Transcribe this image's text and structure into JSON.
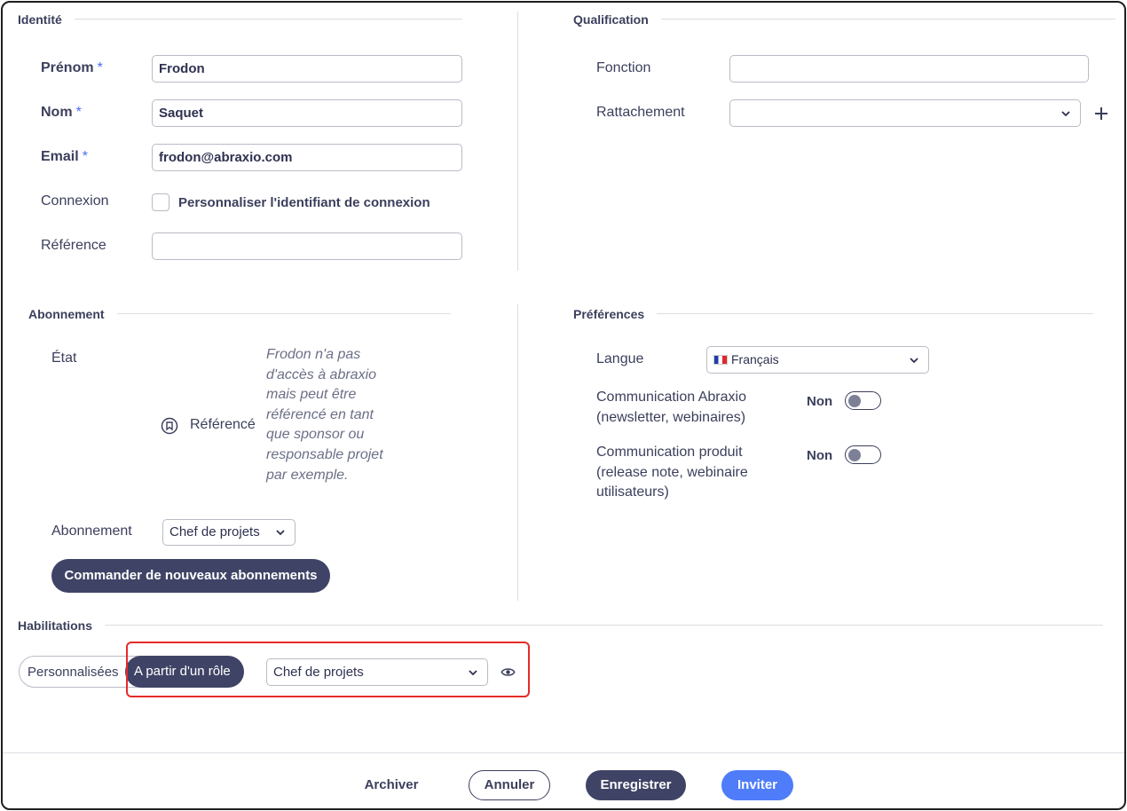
{
  "identite": {
    "title": "Identité",
    "prenom": {
      "label": "Prénom",
      "required": "*",
      "value": "Frodon"
    },
    "nom": {
      "label": "Nom",
      "required": "*",
      "value": "Saquet"
    },
    "email": {
      "label": "Email",
      "required": "*",
      "value": "frodon@abraxio.com"
    },
    "connexion": {
      "label": "Connexion",
      "checkbox_label": "Personnaliser l'identifiant de connexion"
    },
    "reference": {
      "label": "Référence",
      "value": ""
    }
  },
  "qualification": {
    "title": "Qualification",
    "fonction": {
      "label": "Fonction",
      "value": ""
    },
    "rattachement": {
      "label": "Rattachement",
      "value": ""
    }
  },
  "abonnement": {
    "title": "Abonnement",
    "etat_label": "État",
    "etat_value": "Référencé",
    "etat_note": "Frodon n'a pas d'accès à abraxio mais peut être référencé en tant que sponsor ou responsable projet par exemple.",
    "abonnement_label": "Abonnement",
    "abonnement_value": "Chef de projets",
    "order_button": "Commander de nouveaux abonnements"
  },
  "preferences": {
    "title": "Préférences",
    "langue": {
      "label": "Langue",
      "value": "Français",
      "flag": "🇫🇷"
    },
    "comm_abraxio": {
      "label_line1": "Communication Abraxio",
      "label_line2": "(newsletter, webinaires)",
      "state": "Non"
    },
    "comm_produit": {
      "label_line1": "Communication produit",
      "label_line2": "(release note, webinaire",
      "label_line3": "utilisateurs)",
      "state": "Non"
    }
  },
  "habilitations": {
    "title": "Habilitations",
    "option_custom": "Personnalisées",
    "option_role": "A partir d'un rôle",
    "role_value": "Chef de projets"
  },
  "footer": {
    "archive": "Archiver",
    "cancel": "Annuler",
    "save": "Enregistrer",
    "invite": "Inviter"
  },
  "colors": {
    "primary_dark": "#3f4466",
    "accent_blue": "#4f7df9",
    "highlight_red": "#e52b2b"
  }
}
